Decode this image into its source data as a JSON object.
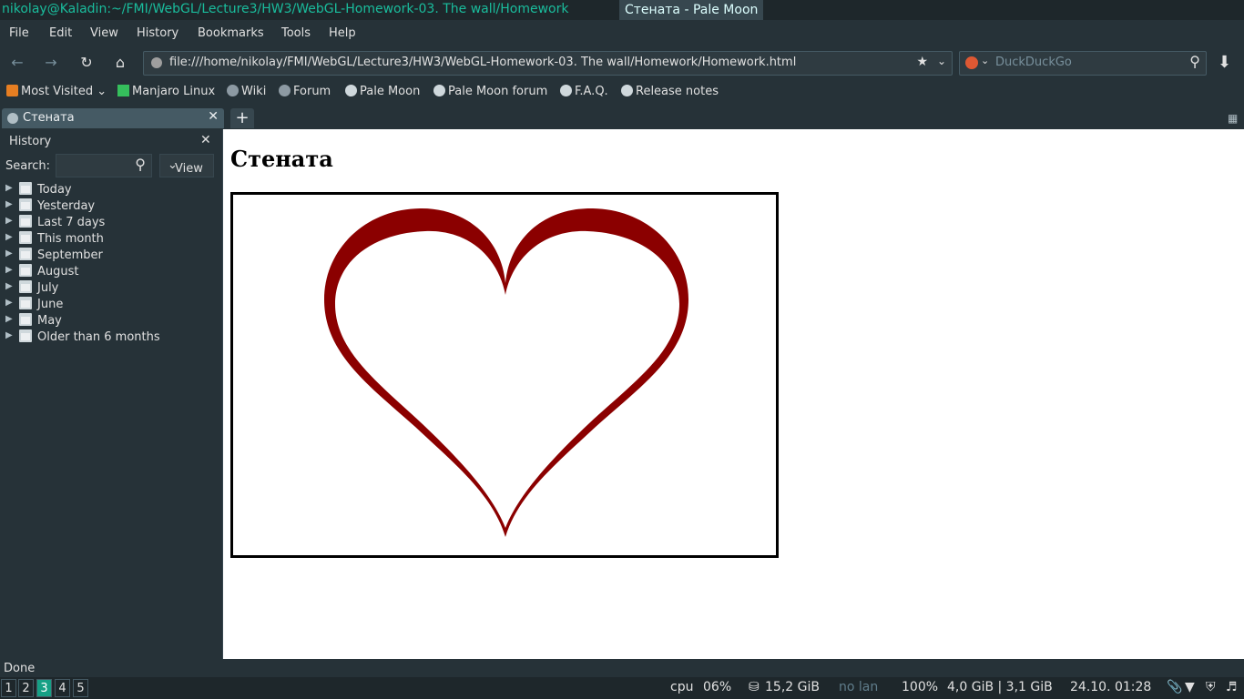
{
  "window": {
    "terminal_title": "nikolay@Kaladin:~/FMI/WebGL/Lecture3/HW3/WebGL-Homework-03. The wall/Homework",
    "browser_title": "Стената - Pale Moon"
  },
  "menu": [
    "File",
    "Edit",
    "View",
    "History",
    "Bookmarks",
    "Tools",
    "Help"
  ],
  "nav": {
    "url": "file:///home/nikolay/FMI/WebGL/Lecture3/HW3/WebGL-Homework-03. The wall/Homework/Homework.html",
    "search_placeholder": "DuckDuckGo"
  },
  "bookmarks": [
    {
      "label": "Most Visited",
      "icon": "most-visited-icon"
    },
    {
      "label": "Manjaro Linux",
      "icon": "manjaro-icon"
    },
    {
      "label": "Wiki",
      "icon": "globe-icon"
    },
    {
      "label": "Forum",
      "icon": "globe-icon"
    },
    {
      "label": "Pale Moon",
      "icon": "moon-icon"
    },
    {
      "label": "Pale Moon forum",
      "icon": "moon-icon"
    },
    {
      "label": "F.A.Q.",
      "icon": "moon-icon"
    },
    {
      "label": "Release notes",
      "icon": "moon-icon"
    }
  ],
  "tab": {
    "label": "Стената"
  },
  "sidebar": {
    "title": "History",
    "search_label": "Search:",
    "view_label": "View",
    "items": [
      "Today",
      "Yesterday",
      "Last 7 days",
      "This month",
      "September",
      "August",
      "July",
      "June",
      "May",
      "Older than 6 months"
    ]
  },
  "page": {
    "heading": "Стената",
    "heart_color": "#8b0000"
  },
  "status": {
    "text": "Done"
  },
  "panel": {
    "workspaces": [
      "1",
      "2",
      "3",
      "4",
      "5"
    ],
    "active_workspace": "3",
    "cpu_label": "cpu",
    "cpu_value": "06%",
    "disk": "15,2 GiB",
    "lan": "no lan",
    "battery": "100%",
    "memory": "4,0 GiB | 3,1 GiB",
    "datetime": "24.10. 01:28"
  }
}
